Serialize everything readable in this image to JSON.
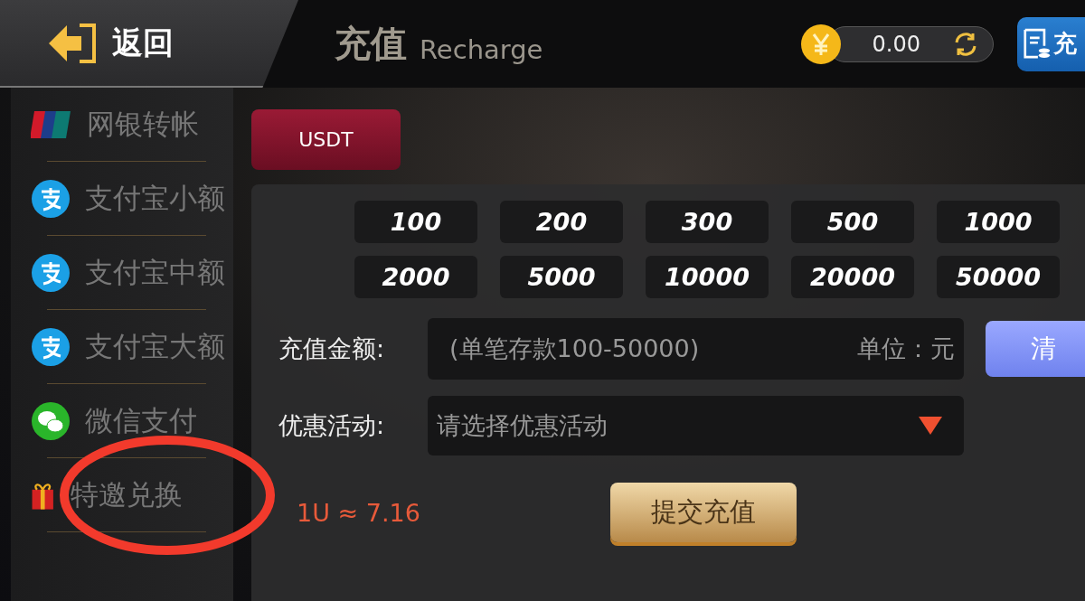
{
  "header": {
    "back": "返回",
    "title": "充值",
    "subtitle": "Recharge",
    "balance": "0.00",
    "action_button": "充"
  },
  "sidebar": {
    "items": [
      {
        "label": "网银转帐",
        "kind": "unionpay"
      },
      {
        "label": "支付宝小额",
        "kind": "alipay"
      },
      {
        "label": "支付宝中额",
        "kind": "alipay"
      },
      {
        "label": "支付宝大额",
        "kind": "alipay"
      },
      {
        "label": "微信支付",
        "kind": "wechat"
      },
      {
        "label": "特邀兑换",
        "kind": "gift"
      }
    ]
  },
  "tabs": [
    {
      "label": "USDT",
      "selected": true
    }
  ],
  "amounts": [
    "100",
    "200",
    "300",
    "500",
    "1000",
    "2000",
    "5000",
    "10000",
    "20000",
    "50000"
  ],
  "form": {
    "amount_label": "充值金额:",
    "amount_placeholder": "(单笔存款100-50000)",
    "unit": "单位：元",
    "clear_button": "清",
    "promo_label": "优惠活动:",
    "promo_placeholder": "请选择优惠活动",
    "rate": "1U ≈ 7.16",
    "submit": "提交充值"
  }
}
